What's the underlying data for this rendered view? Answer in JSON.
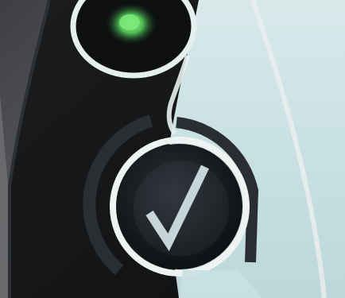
{
  "scene": {
    "subject": "device-control-panel",
    "status_led": {
      "icon": "status-light-icon",
      "state": "on",
      "color": "#56c95a"
    },
    "confirm_control": {
      "icon": "checkmark-icon",
      "symbol": "✓"
    }
  },
  "colors": {
    "housing": "#4a4b4e",
    "panel_dark": "#151719",
    "panel_light": "#cfe4e6",
    "frame": "#ecefed",
    "ring_dark": "#2a2e32",
    "check": "#d7e4e6"
  }
}
